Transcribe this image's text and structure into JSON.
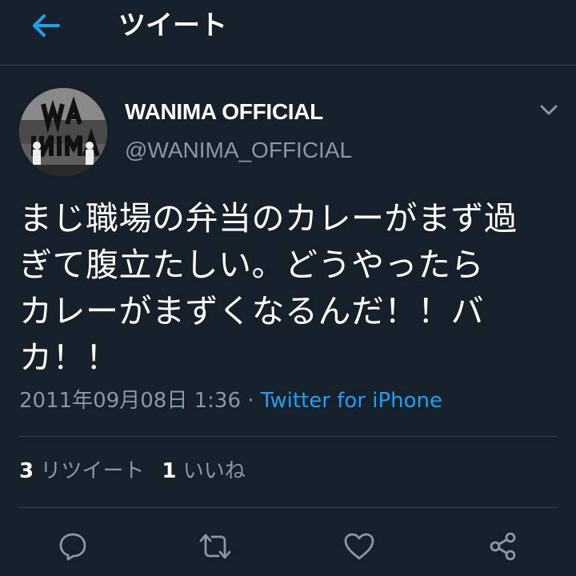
{
  "header": {
    "back_icon": "arrow-left-icon",
    "title": "ツイート"
  },
  "tweet": {
    "display_name": "WANIMA OFFICIAL",
    "handle": "@WANIMA_OFFICIAL",
    "text": "まじ職場の弁当のカレーがまず過\nぎて腹立たしい。どうやったら\nカレーがまずくなるんだ！！バ\nカ！！",
    "timestamp": "2011年09月08日 1:36",
    "separator": "·",
    "source": "Twitter for iPhone"
  },
  "stats": {
    "retweet_count": "3",
    "retweet_label": "リツイート",
    "like_count": "1",
    "like_label": "いいね"
  },
  "actions": [
    "reply-icon",
    "retweet-icon",
    "like-icon",
    "share-icon"
  ],
  "colors": {
    "background": "#15202b",
    "accent": "#1da1f2",
    "muted": "#8899a6",
    "divider": "#38444d"
  }
}
